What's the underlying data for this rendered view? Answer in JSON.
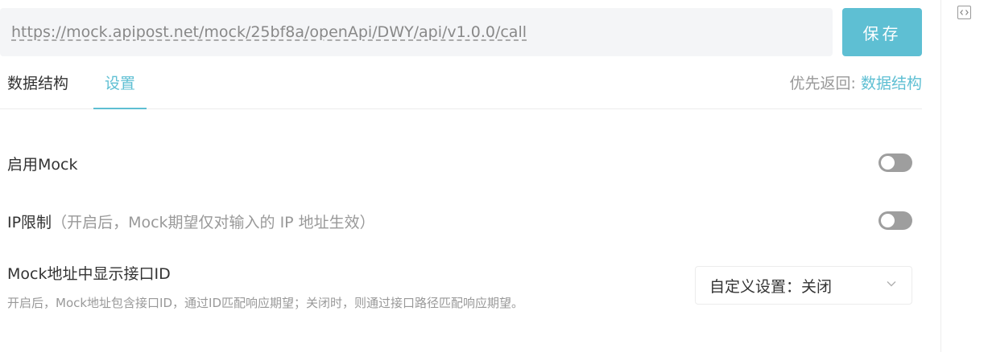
{
  "url_bar": {
    "url": "https://mock.apipost.net/mock/25bf8a/openApi/DWY/api/v1.0.0/call"
  },
  "toolbar": {
    "save_label": "保存"
  },
  "tabs": [
    {
      "label": "数据结构",
      "active": false
    },
    {
      "label": "设置",
      "active": true
    }
  ],
  "priority": {
    "label": "优先返回:",
    "value": "数据结构"
  },
  "settings": {
    "enable_mock": {
      "label": "启用Mock",
      "enabled": false
    },
    "ip_limit": {
      "label": "IP限制",
      "hint": "（开启后，Mock期望仅对输入的 IP 地址生效）",
      "enabled": false
    },
    "mock_url_id": {
      "label": "Mock地址中显示接口ID",
      "description": "开启后，Mock地址包含接口ID，通过ID匹配响应期望；关闭时，则通过接口路径匹配响应期望。",
      "selected": "自定义设置：关闭"
    }
  },
  "icons": {
    "side": "code-icon",
    "select": "chevron-down-icon"
  },
  "colors": {
    "accent": "#5ebfd3",
    "toggle_off": "#9e9e9e",
    "muted_text": "#999999"
  }
}
